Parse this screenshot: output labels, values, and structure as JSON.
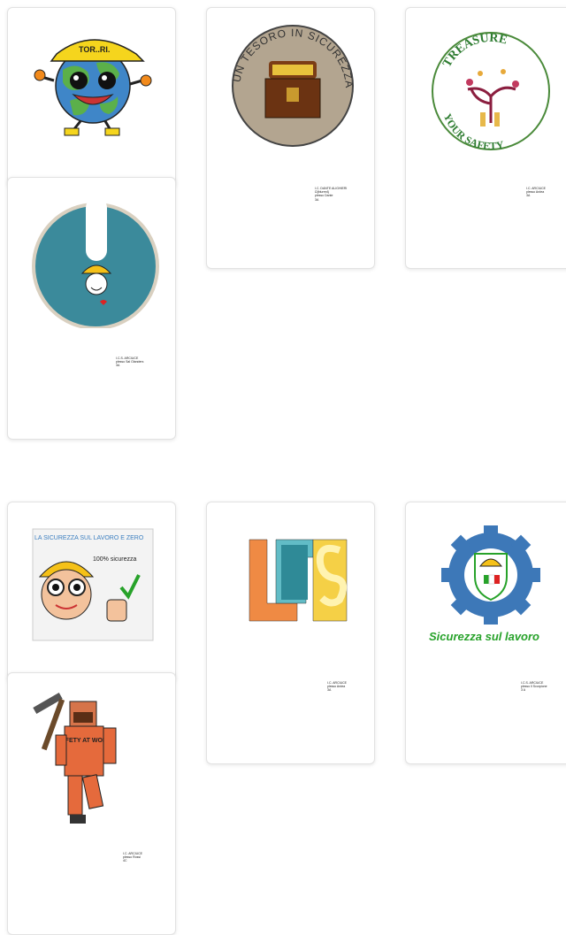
{
  "gallery": {
    "cards": [
      {
        "id": "card-1",
        "logo": "world-helmet-mascot",
        "helmet_text": "TOR..RI.",
        "caption": [
          "",
          "",
          ""
        ]
      },
      {
        "id": "card-2",
        "logo": "treasure-chest-seal",
        "seal_text": "UN TESORO IN SICUREZZA",
        "caption": [
          "I.C. DANTE ALIGHIERI",
          "Ω{blurred}",
          "plesso Dante",
          "3A"
        ]
      },
      {
        "id": "card-3",
        "logo": "treasure-tree-seal",
        "seal_top": "TREASURE",
        "seal_bottom": "YOUR SAFETY",
        "caption": [
          "I.C. ARCIUCE",
          "plesso Ardea",
          "3A"
        ]
      },
      {
        "id": "card-4",
        "logo": "exclamation-helmet-sign",
        "caption": [
          "I.C.S. ARCIUCE",
          "plesso Sal Olanders",
          "3A"
        ]
      },
      {
        "id": "card-5",
        "logo": "helmet-worker-drawing",
        "banner_text": "LA SICUREZZA SUL LAVORO E ZERO",
        "badge_text": "100% sicurezza",
        "caption": [
          "",
          ""
        ]
      },
      {
        "id": "card-6",
        "logo": "lis-blocks",
        "caption": [
          "I.C. ARCIUCE",
          "plesso Ardea",
          "3A"
        ]
      },
      {
        "id": "card-7",
        "logo": "gear-shield-helmet",
        "slogan": "Sicurezza sul lavoro",
        "caption": [
          "I.C.S. ARCIUCE",
          "plesso Il Scorpione",
          "3 A"
        ]
      },
      {
        "id": "card-8",
        "logo": "miner-safety-at-work",
        "shirt_text": "SAFETY AT WORK",
        "caption": [
          "I.C. ARCIUCE",
          "plesso Rossi",
          "4C"
        ]
      }
    ]
  }
}
